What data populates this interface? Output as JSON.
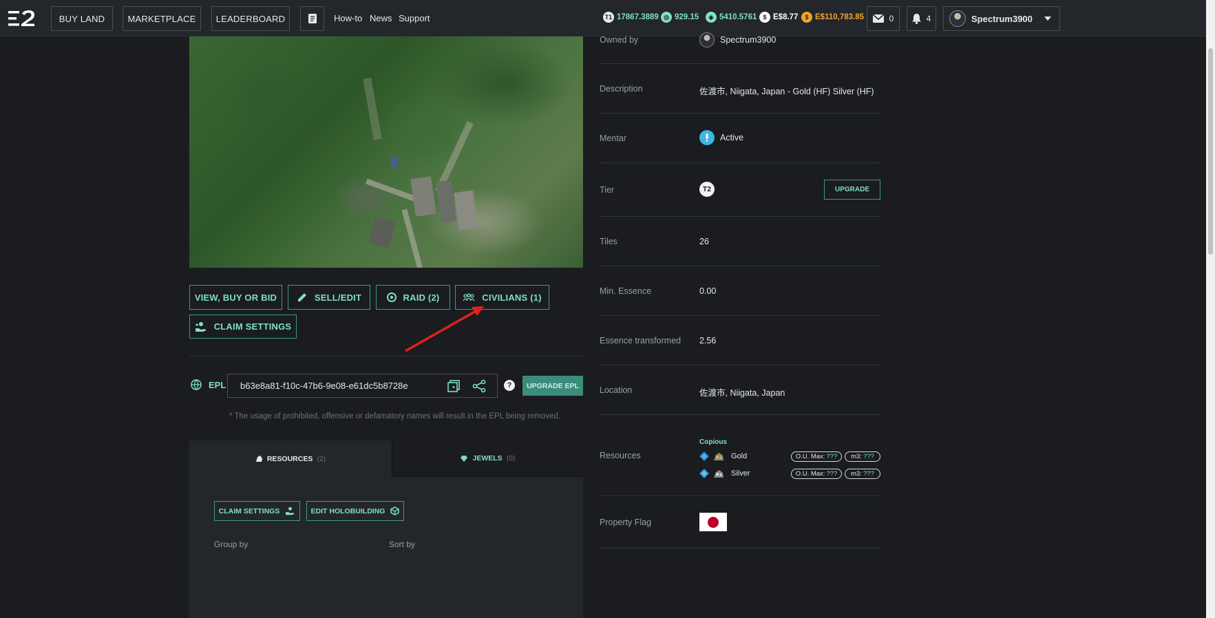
{
  "nav": {
    "buy_land": "BUY LAND",
    "marketplace": "MARKETPLACE",
    "leaderboard": "LEADERBOARD",
    "howto": "How-to",
    "news": "News",
    "support": "Support"
  },
  "balances": [
    {
      "icon": "t1-icon",
      "glyph": "T1",
      "value": "17867.3889",
      "color": "#7fe0c6"
    },
    {
      "icon": "tokens-icon",
      "glyph": "◎",
      "value": "929.15",
      "color": "#7fe0c6"
    },
    {
      "icon": "essence-icon",
      "glyph": "◈",
      "value": "5410.5761",
      "color": "#7fe0c6"
    },
    {
      "icon": "dollar-icon",
      "glyph": "$",
      "value": "E$8.77",
      "color": "#ffffff"
    },
    {
      "icon": "gold-coin-icon",
      "glyph": "$",
      "value": "E$110,783.85",
      "color": "#f0a42a"
    }
  ],
  "header": {
    "mail_count": "0",
    "notif_count": "4",
    "username": "Spectrum3900"
  },
  "actions": {
    "view_buy": "VIEW, BUY OR BID",
    "sell_edit": "SELL/EDIT",
    "raid": "RAID (2)",
    "civilians": "CIVILIANS (1)",
    "claim_settings": "CLAIM SETTINGS"
  },
  "epl": {
    "label": "EPL",
    "value": "b63e8a81-f10c-47b6-9e08-e61dc5b8728e",
    "upgrade": "UPGRADE EPL",
    "help": "?",
    "note": "* The usage of prohibited, offensive or defamatory names will result in the EPL being removed."
  },
  "tabs": {
    "resources": "RESOURCES",
    "resources_count": "(2)",
    "jewels": "JEWELS",
    "jewels_count": "(0)"
  },
  "resources_panel": {
    "claim_settings": "CLAIM SETTINGS",
    "edit_holobuilding": "EDIT HOLOBUILDING",
    "group_by": "Group by",
    "sort_by": "Sort by"
  },
  "property": {
    "owned_by_label": "Owned by",
    "owned_by": "Spectrum3900",
    "description_label": "Description",
    "description": "佐渡市, Niigata, Japan - Gold (HF) Silver (HF)",
    "mentar_label": "Mentar",
    "mentar": "Active",
    "tier_label": "Tier",
    "tier": "T2",
    "upgrade": "UPGRADE",
    "tiles_label": "Tiles",
    "tiles": "26",
    "min_essence_label": "Min. Essence",
    "min_essence": "0.00",
    "essence_transformed_label": "Essence transformed",
    "essence_transformed": "2.56",
    "location_label": "Location",
    "location": "佐渡市, Niigata, Japan",
    "resources_label": "Resources",
    "resources_grade": "Copious",
    "resources": [
      {
        "name": "Gold",
        "ou_label": "O.U. Max:",
        "ou": "???",
        "m3_label": "m3:",
        "m3": "???"
      },
      {
        "name": "Silver",
        "ou_label": "O.U. Max:",
        "ou": "???",
        "m3_label": "m3:",
        "m3": "???"
      }
    ],
    "flag_label": "Property Flag"
  }
}
